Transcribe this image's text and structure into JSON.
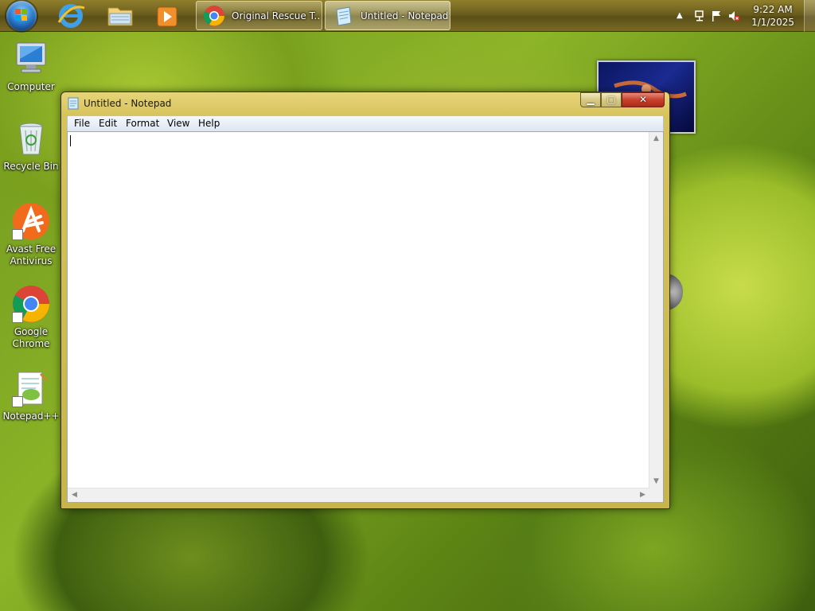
{
  "taskbar": {
    "pinned": [
      {
        "name": "Internet Explorer",
        "icon": "internet-explorer-icon"
      },
      {
        "name": "Windows Explorer",
        "icon": "folder-explorer-icon"
      },
      {
        "name": "Windows Media Player",
        "icon": "media-player-icon"
      }
    ],
    "tasks": [
      {
        "label": "Original Rescue T...",
        "icon": "chrome-icon",
        "active": false
      },
      {
        "label": "Untitled - Notepad",
        "icon": "notepad-icon",
        "active": true
      }
    ],
    "tray": {
      "icons": [
        "show-hidden-icons-arrow",
        "network-icon",
        "action-center-flag-icon",
        "volume-muted-icon"
      ],
      "time": "9:22 AM",
      "date": "1/1/2025"
    }
  },
  "desktop": {
    "icons": [
      {
        "label": "Computer",
        "icon": "computer-icon",
        "shortcut": false
      },
      {
        "label": "Recycle Bin",
        "icon": "recycle-bin-icon",
        "shortcut": false
      },
      {
        "label": "Avast Free Antivirus",
        "icon": "avast-icon",
        "shortcut": true
      },
      {
        "label": "Google Chrome",
        "icon": "chrome-icon",
        "shortcut": true
      },
      {
        "label": "Notepad++",
        "icon": "notepadpp-icon",
        "shortcut": true
      }
    ]
  },
  "window": {
    "title": "Untitled - Notepad",
    "menu": [
      "File",
      "Edit",
      "Format",
      "View",
      "Help"
    ],
    "content": "",
    "caption_buttons": [
      "minimize",
      "maximize",
      "close"
    ]
  },
  "colors": {
    "taskbar": "#6b5e1e",
    "window_frame": "#d7c35c",
    "close_button": "#c8402c",
    "editor_bg": "#ffffff"
  }
}
